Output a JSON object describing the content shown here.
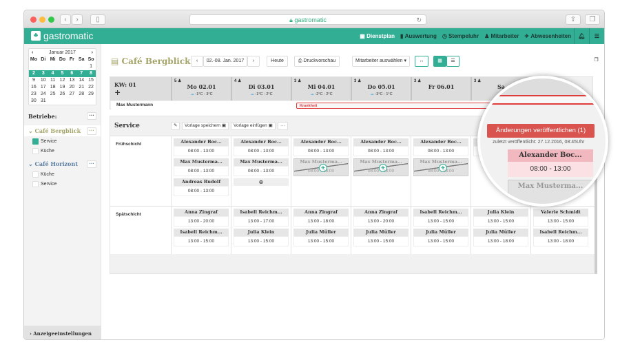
{
  "browser": {
    "url": "gastromatic"
  },
  "app": {
    "logo": "gastromatic",
    "nav": [
      "Dienstplan",
      "Auswertung",
      "Stempeluhr",
      "Mitarbeiter",
      "Abwesenheiten"
    ],
    "accent": "#31ae94"
  },
  "calendar": {
    "month": "Januar 2017",
    "weekdays": [
      "Mo",
      "Di",
      "Mi",
      "Do",
      "Fr",
      "Sa",
      "So"
    ],
    "weeks": [
      [
        "",
        "",
        "",
        "",
        "",
        "",
        "1"
      ],
      [
        "2",
        "3",
        "4",
        "5",
        "6",
        "7",
        "8"
      ],
      [
        "9",
        "10",
        "11",
        "12",
        "13",
        "14",
        "15"
      ],
      [
        "16",
        "17",
        "18",
        "19",
        "20",
        "21",
        "22"
      ],
      [
        "23",
        "24",
        "25",
        "26",
        "27",
        "28",
        "29"
      ],
      [
        "30",
        "31",
        "",
        "",
        "",
        "",
        ""
      ]
    ]
  },
  "sidebar": {
    "betriebe_label": "Betriebe:",
    "more": "···",
    "groups": [
      {
        "name": "Café Bergblick",
        "items": [
          {
            "label": "Service",
            "checked": true
          },
          {
            "label": "Küche",
            "checked": false
          }
        ]
      },
      {
        "name": "Café Horizont",
        "items": [
          {
            "label": "Küche",
            "checked": false
          },
          {
            "label": "Service",
            "checked": false
          }
        ]
      }
    ],
    "footer": "Anzeigeeinstellungen"
  },
  "toolbar": {
    "title": "Café Bergblick",
    "range": "02.-08. Jan. 2017",
    "today": "Heute",
    "print": "Druckvorschau",
    "employee_select": "Mitarbeiter auswählen"
  },
  "week": {
    "kw": "KW: 01",
    "add": "+",
    "days": [
      {
        "count": "5",
        "date": "Mo 02.01",
        "temp": "-1°C - 3°C"
      },
      {
        "count": "4",
        "date": "Di 03.01",
        "temp": "-1°C - 2°C"
      },
      {
        "count": "3",
        "date": "Mi 04.01",
        "temp": "-2°C - 2°C"
      },
      {
        "count": "3",
        "date": "Do 05.01",
        "temp": "-3°C - 1°C"
      },
      {
        "count": "3",
        "date": "Fr 06.01",
        "temp": ""
      },
      {
        "count": "3",
        "date": "Sa",
        "temp": ""
      }
    ],
    "employee": "Max Mustermann",
    "absence": "Krankheit"
  },
  "plan": {
    "section": "Service",
    "save_template": "Vorlage speichern",
    "insert_template": "Vorlage einfügen",
    "more": "···",
    "early": {
      "label": "Frühschicht",
      "cols": [
        [
          {
            "n": "Alexander Boc...",
            "t": "08:00  -  13:00"
          },
          {
            "n": "Max Musterma...",
            "t": "08:00  -  13:00"
          },
          {
            "n": "Andreas Rudolf",
            "t": "08:00  -  13:00"
          }
        ],
        [
          {
            "n": "Alexander Boc...",
            "t": "08:00  -  13:00"
          },
          {
            "n": "Max Musterma...",
            "t": "08:00  -  13:00"
          }
        ],
        [
          {
            "n": "Alexander Boc...",
            "t": "08:00  -  13:00"
          },
          {
            "n": "Max Musterma...",
            "t": "08:00  -  13:00",
            "abs": true
          }
        ],
        [
          {
            "n": "Alexander Boc...",
            "t": "08:00  -  13:00"
          },
          {
            "n": "Max Musterma...",
            "t": "08:00  -  13:00",
            "abs": true
          }
        ],
        [
          {
            "n": "Alexander Boc...",
            "t": "08:00  -  13:00"
          },
          {
            "n": "Max Musterma...",
            "t": "08:00  -  13:00",
            "abs": true
          }
        ],
        [
          {
            "n": "Alexander Boc...",
            "t": "08:00  -  13:00"
          }
        ],
        [
          {
            "n": "Alexander Boc...",
            "t": "08:00  -  13:00"
          }
        ]
      ]
    },
    "late": {
      "label": "Spätschicht",
      "cols": [
        [
          {
            "n": "Anna Zingraf",
            "t": "13:00  -  20:00"
          },
          {
            "n": "Isabell Reichm...",
            "t": "13:00  -  15:00"
          }
        ],
        [
          {
            "n": "Isabell Reichm...",
            "t": "13:00  -  17:00"
          },
          {
            "n": "Julia Klein",
            "t": "13:00  -  15:00"
          }
        ],
        [
          {
            "n": "Anna Zingraf",
            "t": "13:00  -  18:00"
          },
          {
            "n": "Julia Müller",
            "t": "13:00  -  15:00"
          }
        ],
        [
          {
            "n": "Anna Zingraf",
            "t": "13:00  -  20:00"
          },
          {
            "n": "Julia Müller",
            "t": "13:00  -  15:00"
          }
        ],
        [
          {
            "n": "Isabell Reichm...",
            "t": "13:00  -  15:00"
          },
          {
            "n": "Julia Müller",
            "t": "13:00  -  15:00"
          }
        ],
        [
          {
            "n": "Julia Klein",
            "t": "13:00  -  15:00"
          },
          {
            "n": "Julia Müller",
            "t": "13:00  -  18:00"
          }
        ],
        [
          {
            "n": "Valerie Schmidt",
            "t": "13:00  -  15:00"
          },
          {
            "n": "Isabell Reichm...",
            "t": "13:00  -  18:00"
          }
        ]
      ]
    }
  },
  "publish": {
    "label": "Änderungen veröffentlichen (1)",
    "last": "zuletzt veröffentlicht: 27.12.2016, 08:45Uhr",
    "card_name": "Alexander Boc...",
    "card_time": "08:00  -  13:00",
    "abs_name": "Max Musterma...",
    "color": "#d9534f"
  }
}
